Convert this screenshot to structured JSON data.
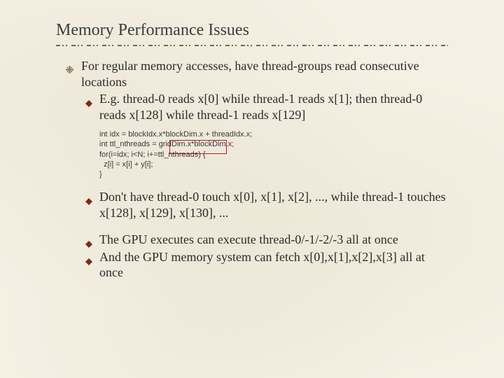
{
  "title": "Memory Performance Issues",
  "bullet_main": "For regular memory accesses, have thread-groups read consecutive locations",
  "bullet_sub1": "E.g. thread-0 reads x[0] while thread-1 reads x[1]; then thread-0 reads x[128] while thread-1 reads x[129]",
  "code": {
    "l1": "int idx = blockIdx.x*blockDim.x + threadIdx.x;",
    "l2": "int ttl_nthreads = gridDim.x*blockDim.x;",
    "l3": "for(i=idx; i<N; i+=ttl_nthreads) {",
    "l4": "  z[i] = x[i] + y[i];",
    "l5": "}"
  },
  "bullet_sub2": "Don't have thread-0 touch x[0], x[1], x[2], ..., while thread-1 touches x[128], x[129], x[130], ...",
  "bullet_sub3": "The GPU executes can execute thread-0/-1/-2/-3 all at once",
  "bullet_sub4": "And the GPU memory system can fetch x[0],x[1],x[2],x[3] all at once"
}
